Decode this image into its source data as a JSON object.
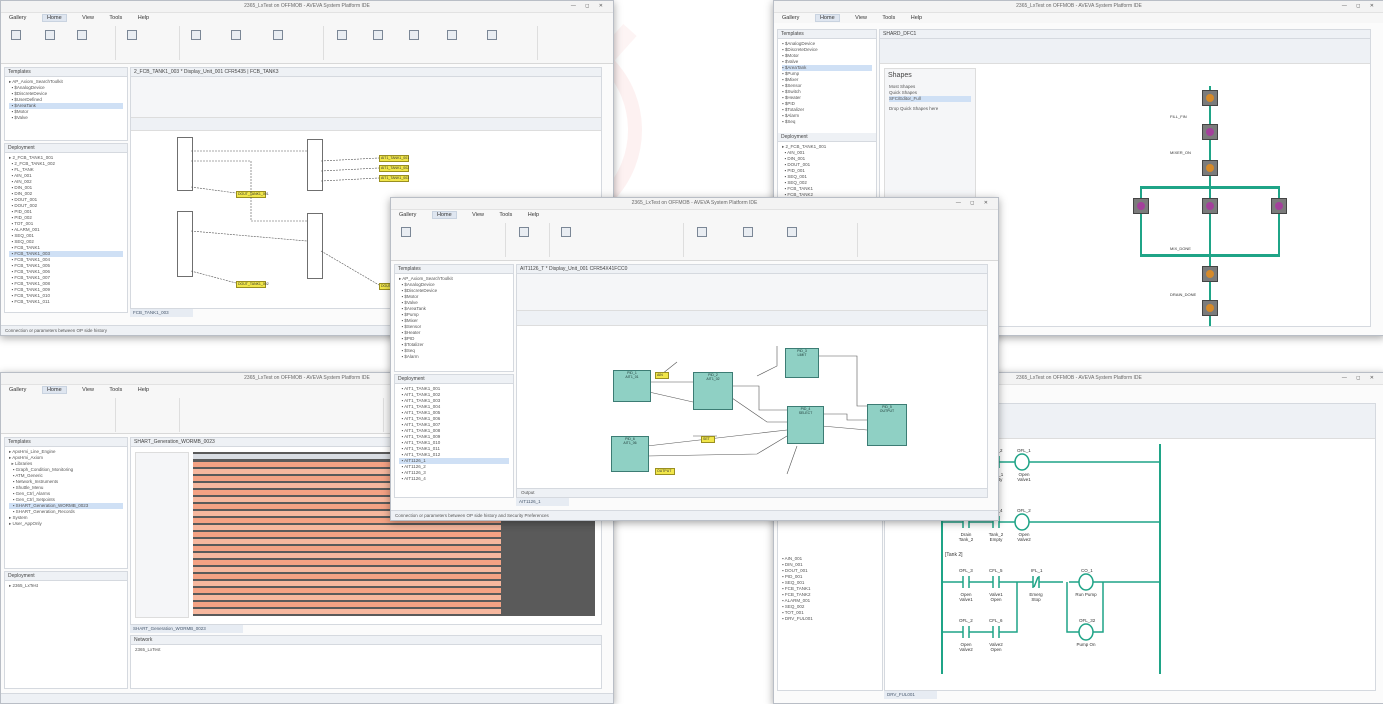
{
  "app_title": "2365_LxTest on OFFMOB - AVEVA System Platform IDE",
  "menu": {
    "gallery": "Gallery",
    "home": "Home",
    "view": "View",
    "tools": "Tools",
    "help": "Help"
  },
  "panes": {
    "templates": "Templates",
    "deployment": "Deployment",
    "shapes": "Shapes"
  },
  "win1": {
    "doc_title": "2_FCB_TANK1_003 * Display_Unit_001 CFR5435 | FCB_TANK3",
    "tab": "FCB_TANK1_003",
    "status": "Connection or parameters between OP side history"
  },
  "win2": {
    "doc_title": "SHARD_DFC1",
    "shapes_items": [
      "Most Shapes",
      "Quick Shapes",
      "SFC/Editor_Full",
      "Drop Quick Shapes here"
    ],
    "sfc_labels": [
      "FILL_FIN",
      "MIXER_ON",
      "MIX_DONE",
      "DRAIN_DONE"
    ],
    "tab": "SHARD_DFC1"
  },
  "win3": {
    "doc_title": "SHART_Generation_WORMB_0023",
    "tab": "SHART_Generation_WORMB_0023",
    "network": "Network",
    "network_item": "2365_LxTest"
  },
  "win4": {
    "doc_title": "AIT1126_T * Display_Unit_001 CFR54X41FCC0",
    "tab": "AIT1126_1",
    "status": "Connection or parameters between OP side history and Security Preferences"
  },
  "win5": {
    "tab": "DRV_FUL001",
    "rung_labels": [
      "CFL_1",
      "CFL_2",
      "OFL_1",
      "CFL_3",
      "CFL_4",
      "OFL_2",
      "OFL_3",
      "CFL_5",
      "IFL_1",
      "CO_1",
      "OFL_2",
      "CFL_6",
      "OFL_32"
    ],
    "text_labels": [
      "Drain Tank_1",
      "Tank_1 Empty",
      "Open Valve1",
      "Drain Tank_2",
      "Tank_2 Empty",
      "Open Valve2",
      "Open Valve1",
      "Valve1 Open",
      "Emerg Stop",
      "Run Pump",
      "Open Valve2",
      "Valve2 Open",
      "Pump On",
      "[Tank 2]"
    ]
  },
  "colors": {
    "teal": "#1fa487",
    "fbd": "#8fd0c4",
    "yellow": "#f1e64a",
    "salmon": "#f4a284",
    "grid_gray": "#5a5a5a",
    "watermark": "#e23a3a"
  }
}
